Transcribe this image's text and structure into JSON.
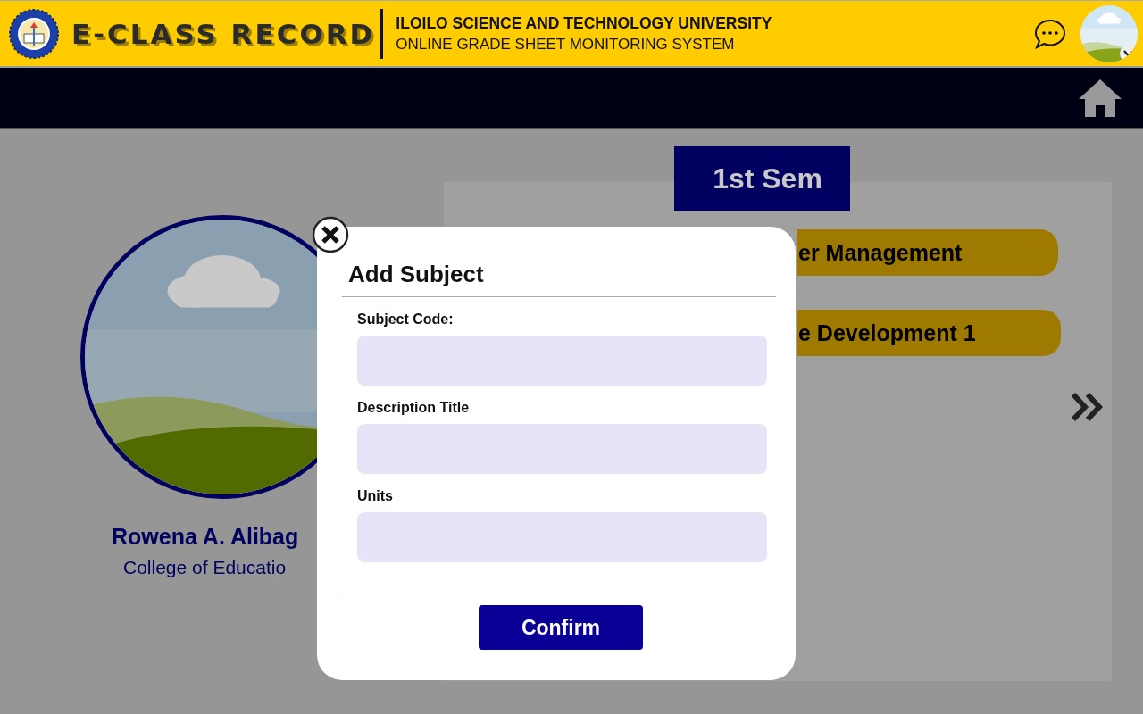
{
  "header": {
    "title": "E-CLASS RECORD",
    "university": "ILOILO SCIENCE AND TECHNOLOGY UNIVERSITY",
    "system": "ONLINE GRADE SHEET MONITORING SYSTEM"
  },
  "profile": {
    "name": "Rowena A. Alibag",
    "college": "College of Educatio"
  },
  "semester_tab": {
    "label": "1st Sem"
  },
  "subjects": [
    {
      "title": "er Management"
    },
    {
      "title": "e Development 1"
    }
  ],
  "modal": {
    "title": "Add Subject",
    "fields": [
      {
        "label": "Subject Code:"
      },
      {
        "label": "Description Title"
      },
      {
        "label": "Units"
      }
    ],
    "confirm": "Confirm"
  }
}
